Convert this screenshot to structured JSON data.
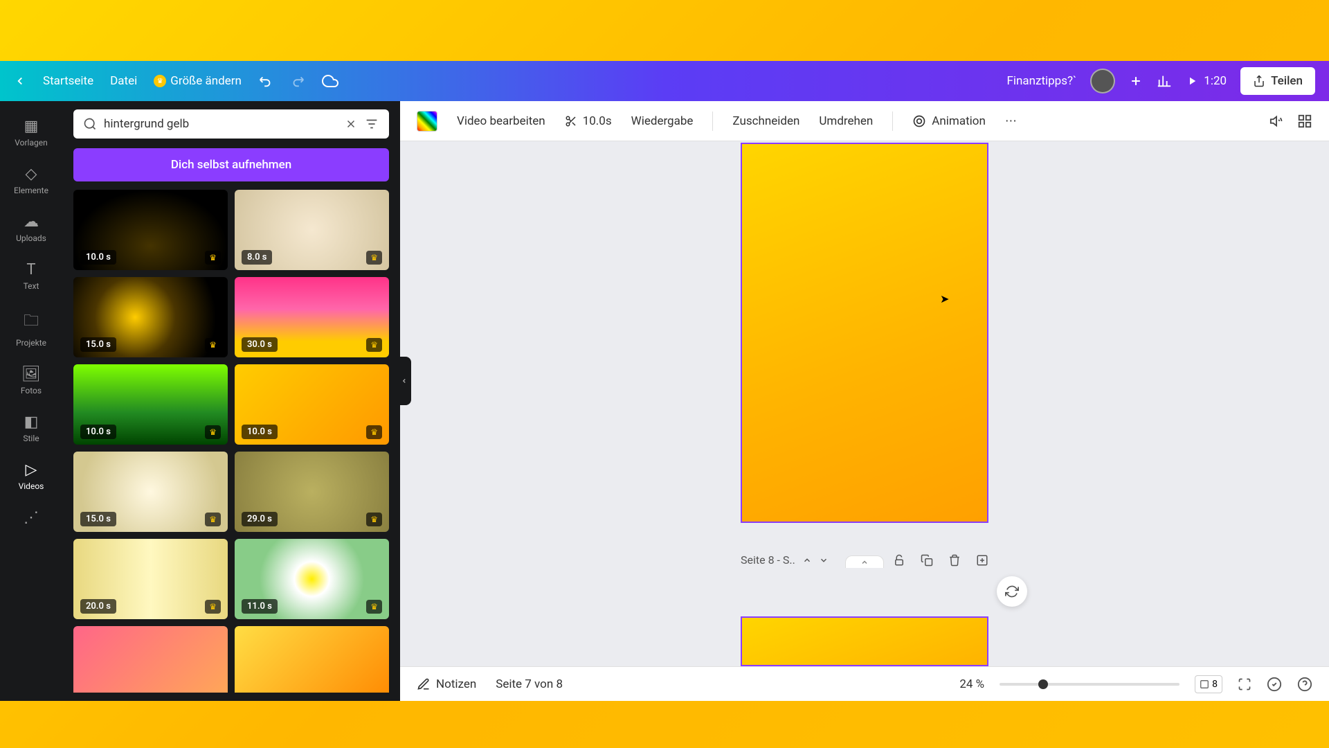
{
  "top": {
    "home": "Startseite",
    "file": "Datei",
    "resize": "Größe ändern",
    "doc_title": "Finanztipps?`",
    "duration": "1:20",
    "share": "Teilen"
  },
  "rail": {
    "templates": "Vorlagen",
    "elements": "Elemente",
    "uploads": "Uploads",
    "text": "Text",
    "projects": "Projekte",
    "photos": "Fotos",
    "styles": "Stile",
    "videos": "Videos"
  },
  "search": {
    "value": "hintergrund gelb",
    "record": "Dich selbst aufnehmen"
  },
  "videos": [
    {
      "d": "10.0 s",
      "p": true,
      "cls": "thumb-bg-1"
    },
    {
      "d": "8.0 s",
      "p": true,
      "cls": "thumb-bg-2"
    },
    {
      "d": "15.0 s",
      "p": true,
      "cls": "thumb-bg-3"
    },
    {
      "d": "30.0 s",
      "p": true,
      "cls": "thumb-bg-4"
    },
    {
      "d": "10.0 s",
      "p": true,
      "cls": "thumb-bg-5"
    },
    {
      "d": "10.0 s",
      "p": true,
      "cls": "thumb-bg-6"
    },
    {
      "d": "15.0 s",
      "p": true,
      "cls": "thumb-bg-7"
    },
    {
      "d": "29.0 s",
      "p": true,
      "cls": "thumb-bg-8"
    },
    {
      "d": "20.0 s",
      "p": true,
      "cls": "thumb-bg-9"
    },
    {
      "d": "11.0 s",
      "p": true,
      "cls": "thumb-bg-10"
    },
    {
      "d": "",
      "p": false,
      "cls": "thumb-bg-11"
    },
    {
      "d": "",
      "p": false,
      "cls": "thumb-bg-12"
    }
  ],
  "context": {
    "edit": "Video bearbeiten",
    "clip": "10.0s",
    "playback": "Wiedergabe",
    "crop": "Zuschneiden",
    "flip": "Umdrehen",
    "anim": "Animation"
  },
  "page_label": "Seite 8 - S..",
  "bottom": {
    "notes": "Notizen",
    "page_of": "Seite 7 von 8",
    "zoom": "24 %",
    "pages_count": "8"
  }
}
